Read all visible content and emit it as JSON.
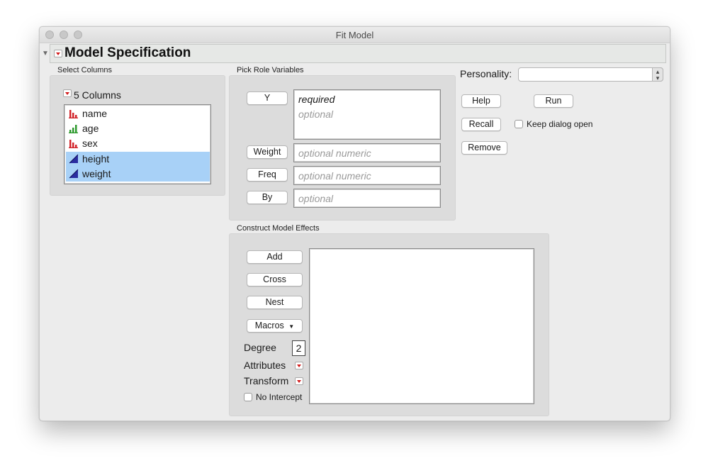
{
  "window": {
    "title": "Fit Model"
  },
  "header": {
    "title": "Model Specification"
  },
  "select_columns": {
    "label": "Select Columns",
    "count_label": "5 Columns",
    "columns": [
      {
        "name": "name",
        "type": "nominal",
        "selected": false
      },
      {
        "name": "age",
        "type": "ordinal",
        "selected": false
      },
      {
        "name": "sex",
        "type": "nominal",
        "selected": false
      },
      {
        "name": "height",
        "type": "continuous",
        "selected": true
      },
      {
        "name": "weight",
        "type": "continuous",
        "selected": true
      }
    ]
  },
  "roles": {
    "label": "Pick Role Variables",
    "y": {
      "button": "Y",
      "line1": "required",
      "line2": "optional"
    },
    "weight": {
      "button": "Weight",
      "placeholder": "optional numeric"
    },
    "freq": {
      "button": "Freq",
      "placeholder": "optional numeric"
    },
    "by": {
      "button": "By",
      "placeholder": "optional"
    }
  },
  "personality": {
    "label": "Personality:",
    "value": ""
  },
  "actions": {
    "help": "Help",
    "run": "Run",
    "recall": "Recall",
    "keep_open": "Keep dialog open",
    "remove": "Remove"
  },
  "effects": {
    "label": "Construct Model Effects",
    "add": "Add",
    "cross": "Cross",
    "nest": "Nest",
    "macros": "Macros",
    "degree_label": "Degree",
    "degree_value": "2",
    "attributes": "Attributes",
    "transform": "Transform",
    "no_intercept": "No Intercept"
  },
  "icons": {
    "nominal": "nominal-bars-icon",
    "ordinal": "ordinal-bars-icon",
    "continuous": "continuous-triangle-icon"
  },
  "colors": {
    "selection": "#a8d1f7",
    "nominal": "#d2252b",
    "ordinal": "#2e9a2e",
    "continuous": "#2a2ca0",
    "menu_arrow": "#d21a1a"
  }
}
